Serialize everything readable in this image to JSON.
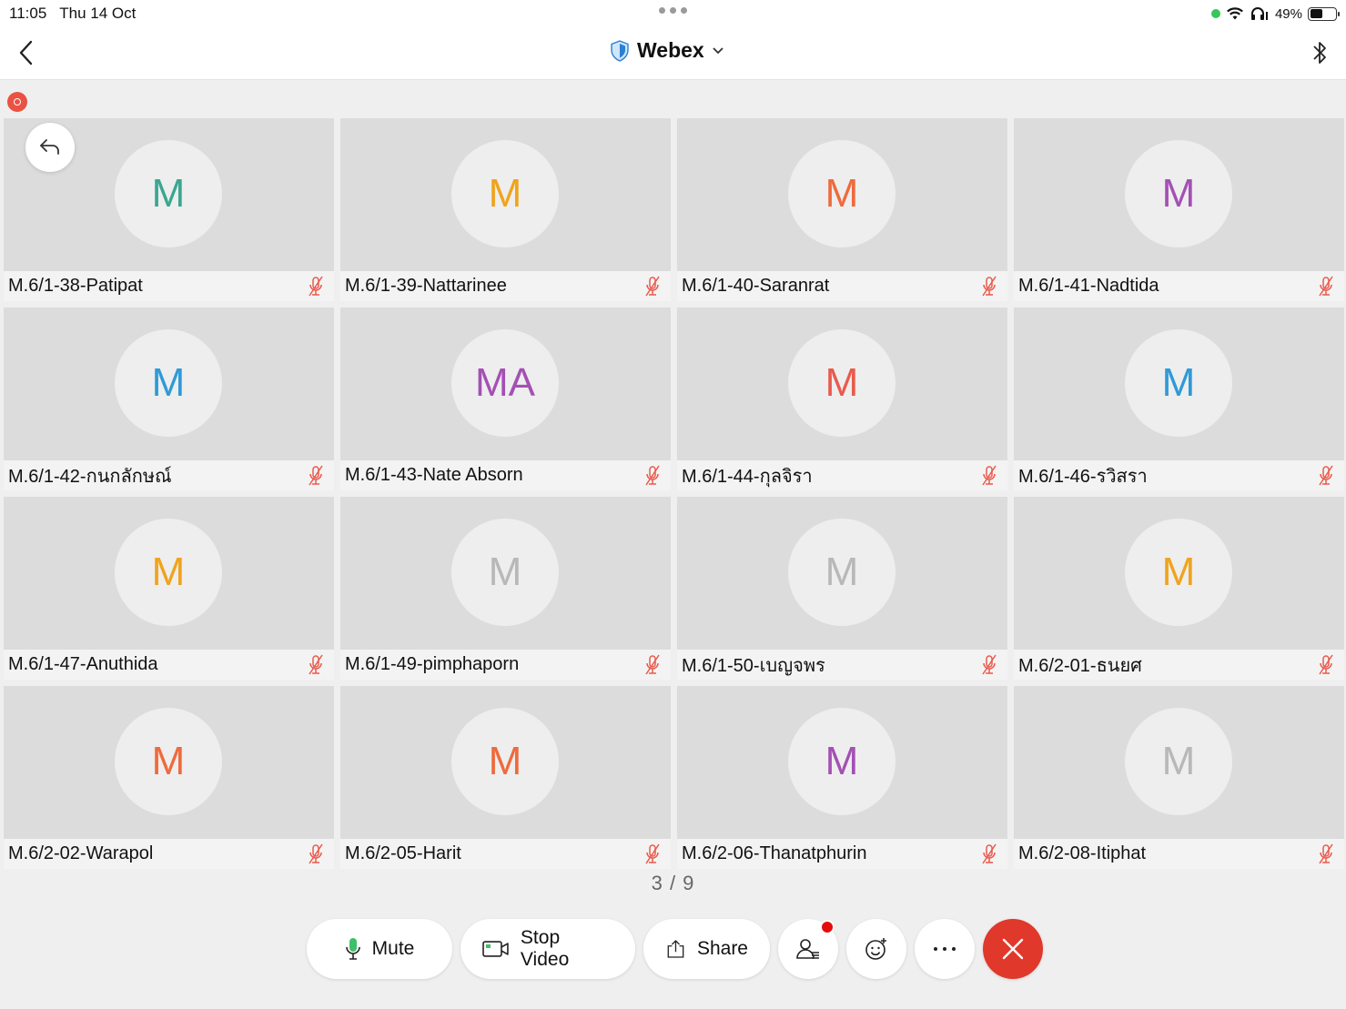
{
  "status_bar": {
    "time": "11:05",
    "date": "Thu 14 Oct",
    "battery_pct": "49%",
    "battery_level": 0.49
  },
  "header": {
    "title": "Webex"
  },
  "colors": {
    "teal": "#3aa690",
    "orange": "#f0a41c",
    "red_orange": "#ef6a3c",
    "purple": "#a450b4",
    "blue": "#2f9ad6",
    "grey": "#b8b8b8",
    "salmon": "#ea5a4c",
    "end_red": "#e0382a"
  },
  "participants": [
    {
      "initials": "M",
      "name": "M.6/1-38-Patipat",
      "color": "#3aa690"
    },
    {
      "initials": "M",
      "name": "M.6/1-39-Nattarinee",
      "color": "#f0a41c"
    },
    {
      "initials": "M",
      "name": "M.6/1-40-Saranrat",
      "color": "#ef6a3c"
    },
    {
      "initials": "M",
      "name": "M.6/1-41-Nadtida",
      "color": "#a450b4"
    },
    {
      "initials": "M",
      "name": "M.6/1-42-กนกลักษณ์",
      "color": "#2f9ad6"
    },
    {
      "initials": "MA",
      "name": "M.6/1-43-Nate Absorn",
      "color": "#a450b4"
    },
    {
      "initials": "M",
      "name": "M.6/1-44-กุลจิรา",
      "color": "#ea5a4c"
    },
    {
      "initials": "M",
      "name": "M.6/1-46-รวิสรา",
      "color": "#2f9ad6"
    },
    {
      "initials": "M",
      "name": "M.6/1-47-Anuthida",
      "color": "#f0a41c"
    },
    {
      "initials": "M",
      "name": "M.6/1-49-pimphaporn",
      "color": "#b8b8b8"
    },
    {
      "initials": "M",
      "name": "M.6/1-50-เบญจพร",
      "color": "#b8b8b8"
    },
    {
      "initials": "M",
      "name": "M.6/2-01-ธนยศ",
      "color": "#f0a41c"
    },
    {
      "initials": "M",
      "name": "M.6/2-02-Warapol",
      "color": "#ef6a3c"
    },
    {
      "initials": "M",
      "name": "M.6/2-05-Harit",
      "color": "#ef6a3c"
    },
    {
      "initials": "M",
      "name": "M.6/2-06-Thanatphurin",
      "color": "#a450b4"
    },
    {
      "initials": "M",
      "name": "M.6/2-08-Itiphat",
      "color": "#b8b8b8"
    }
  ],
  "pager": "3 / 9",
  "toolbar": {
    "mute_label": "Mute",
    "stop_video_label": "Stop Video",
    "share_label": "Share"
  }
}
